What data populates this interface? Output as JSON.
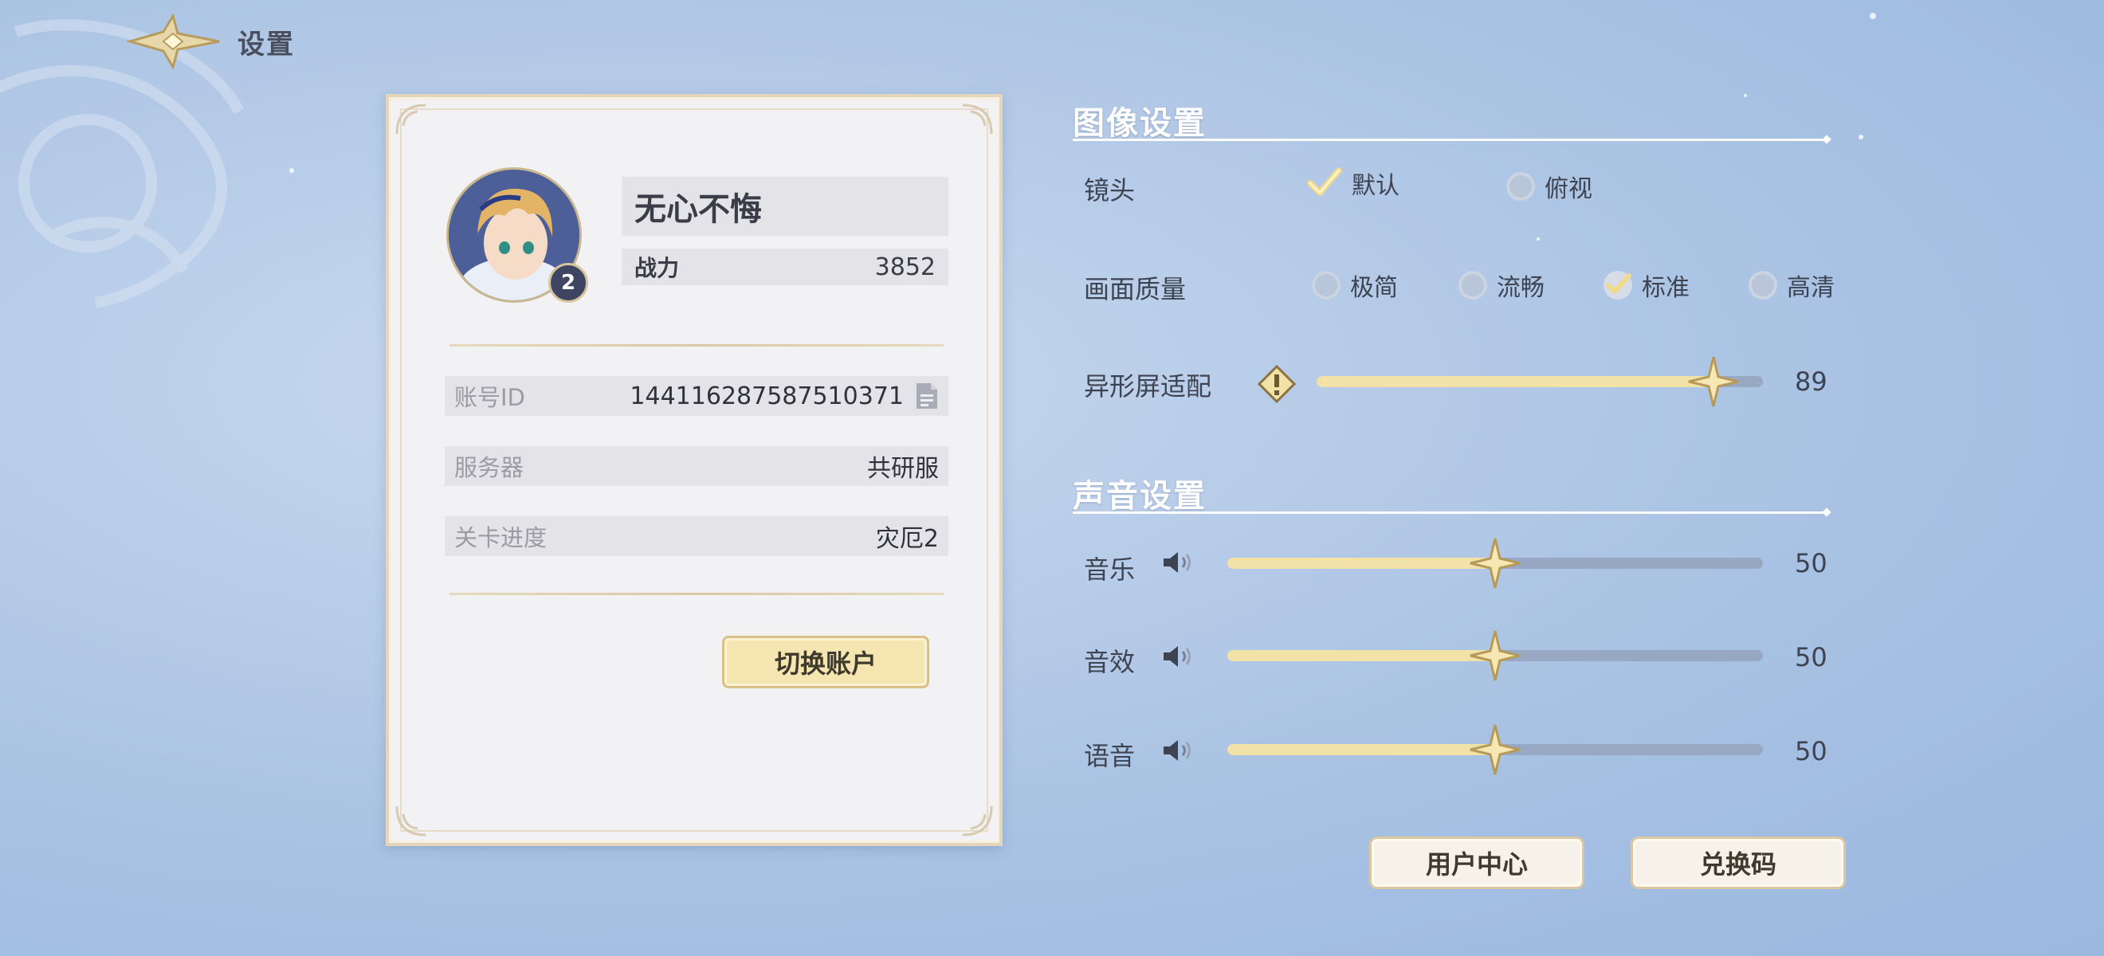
{
  "header": {
    "title": "设置",
    "back_icon": "back-arrow-icon"
  },
  "profile": {
    "name": "无心不悔",
    "power_label": "战力",
    "power_value": "3852",
    "level": "2",
    "account_id_label": "账号ID",
    "account_id_value": "144116287587510371",
    "server_label": "服务器",
    "server_value": "共研服",
    "progress_label": "关卡进度",
    "progress_value": "灾厄2",
    "switch_button": "切换账户"
  },
  "graphics": {
    "section_title": "图像设置",
    "camera_label": "镜头",
    "camera_options": [
      {
        "label": "默认",
        "selected": true
      },
      {
        "label": "俯视",
        "selected": false
      }
    ],
    "quality_label": "画面质量",
    "quality_options": [
      {
        "label": "极简",
        "selected": false
      },
      {
        "label": "流畅",
        "selected": false
      },
      {
        "label": "标准",
        "selected": true
      },
      {
        "label": "高清",
        "selected": false
      }
    ],
    "notch_label": "异形屏适配",
    "notch_value": "89",
    "notch_fraction": 0.89
  },
  "audio": {
    "section_title": "声音设置",
    "music_label": "音乐",
    "music_value": "50",
    "sfx_label": "音效",
    "sfx_value": "50",
    "voice_label": "语音",
    "voice_value": "50",
    "fraction": 0.5
  },
  "footer": {
    "user_center": "用户中心",
    "redeem_code": "兑换码"
  },
  "colors": {
    "accent_gold": "#f3e2a8",
    "slider_track": "#98a8c2",
    "card_bg": "#f2f1f3"
  }
}
